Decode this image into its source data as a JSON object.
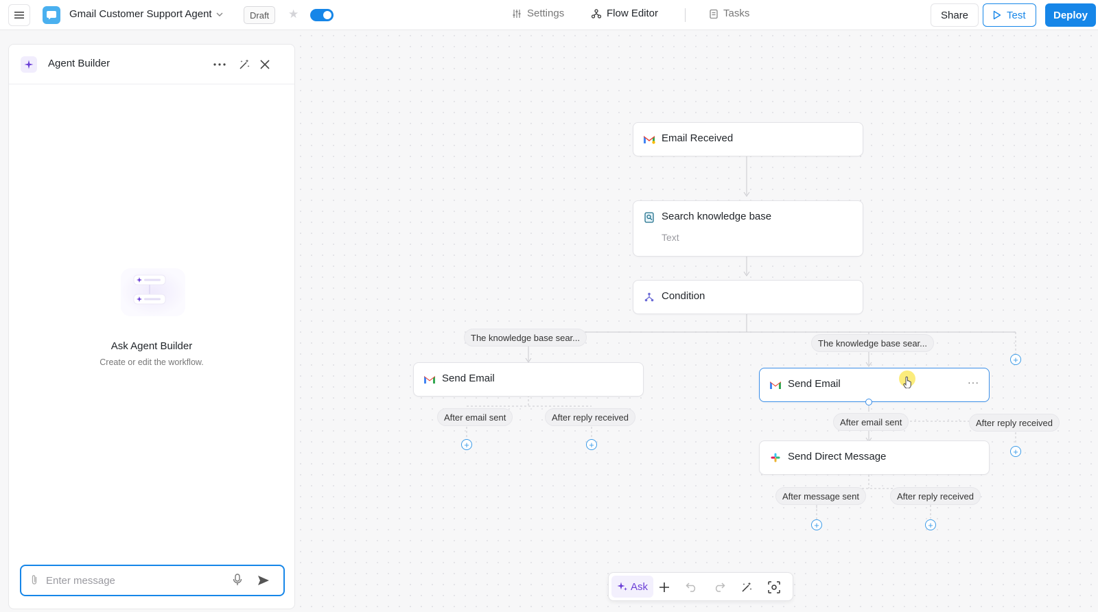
{
  "topbar": {
    "app_title": "Gmail Customer Support Agent",
    "status_badge": "Draft",
    "nav": {
      "settings": "Settings",
      "flow_editor": "Flow Editor",
      "tasks": "Tasks"
    },
    "share_label": "Share",
    "test_label": "Test",
    "deploy_label": "Deploy",
    "colors": {
      "accent": "#1686e8",
      "app_icon": "#4ab0ef"
    }
  },
  "panel": {
    "title": "Agent Builder",
    "empty_title": "Ask Agent Builder",
    "empty_subtitle": "Create or edit the workflow.",
    "message_placeholder": "Enter message",
    "icons": [
      "sparkle-icon",
      "more-horizontal-icon",
      "magic-wand-icon",
      "close-icon",
      "paperclip-icon",
      "microphone-icon",
      "send-icon"
    ]
  },
  "flow": {
    "nodes": {
      "trigger": {
        "title": "Email Received",
        "icon": "gmail-trigger-icon"
      },
      "search": {
        "title": "Search knowledge base",
        "subtitle": "Text",
        "icon": "knowledge-base-icon"
      },
      "condition": {
        "title": "Condition",
        "icon": "condition-branch-icon"
      },
      "send_left": {
        "title": "Send Email",
        "icon": "gmail-icon"
      },
      "send_right": {
        "title": "Send Email",
        "icon": "gmail-icon",
        "selected": true
      },
      "dm": {
        "title": "Send Direct Message",
        "icon": "slack-icon"
      }
    },
    "branch_labels": {
      "left": "The knowledge base sear...",
      "right": "The knowledge base sear..."
    },
    "path_labels": {
      "left_email_sent": "After email sent",
      "left_reply_received": "After reply received",
      "right_email_sent": "After email sent",
      "right_reply_received": "After reply received",
      "dm_message_sent": "After message sent",
      "dm_reply_received": "After reply received"
    }
  },
  "toolbar": {
    "ask_label": "Ask",
    "tools": [
      "add-icon",
      "undo-icon",
      "redo-icon",
      "magic-wand-icon",
      "focus-icon"
    ]
  }
}
